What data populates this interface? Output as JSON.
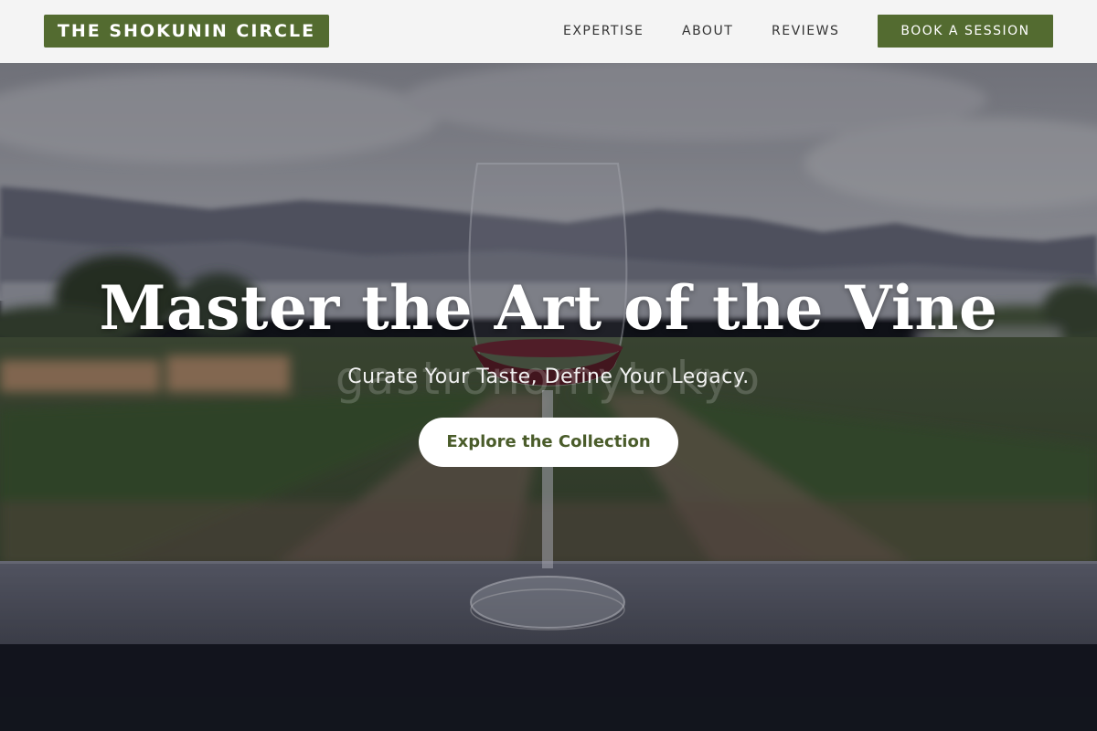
{
  "header": {
    "logo_text": "THE SHOKUNIN CIRCLE",
    "nav": {
      "expertise": "EXPERTISE",
      "about": "ABOUT",
      "reviews": "REVIEWS"
    },
    "cta_label": "BOOK A SESSION"
  },
  "hero": {
    "title": "Master the Art of the Vine",
    "subtitle": "Curate Your Taste, Define Your Legacy.",
    "watermark": "gastronomytokyo",
    "button_label": "Explore the Collection",
    "background_image": "vineyard-wine-glass-photo"
  },
  "colors": {
    "brand_green": "#536b30",
    "header_bg": "#f4f4f4",
    "button_text": "#4a5c2a"
  }
}
